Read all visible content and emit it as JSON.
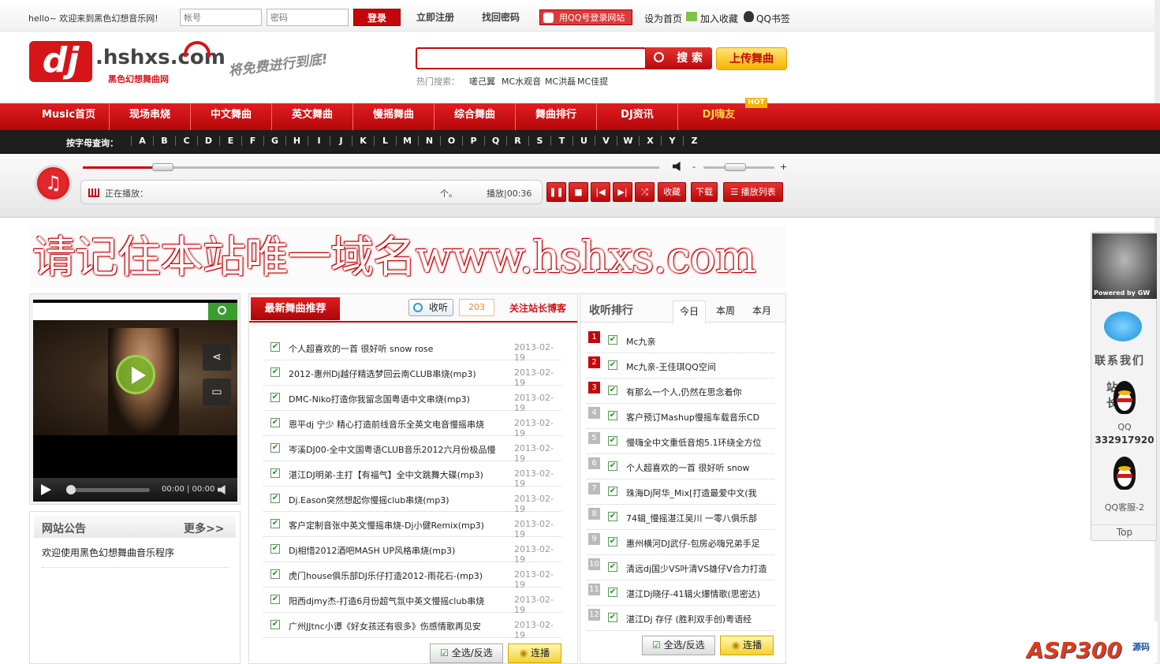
{
  "topbar": {
    "greeting": "hello~ 欢迎来到黑色幻想音乐网!",
    "username_placeholder": "帐号",
    "password_placeholder": "密码",
    "login": "登录",
    "register": "立即注册",
    "find_password": "找回密码",
    "qq_login": "用QQ号登录网站",
    "set_home": "设为首页",
    "add_fav": "加入收藏",
    "qq_bookmark": "QQ书签"
  },
  "header": {
    "logo_mark": "dj",
    "logo_main": ".hshxs.com",
    "logo_sub": "黑色幻想舞曲网",
    "slogan": "将免费进行到底!",
    "search_button": "搜 索",
    "upload_button": "上传舞曲",
    "hot_label": "热门搜索：",
    "hot_keywords": [
      "嗟己翼",
      "MC水观音",
      "MC洪磊",
      "MC佳提"
    ]
  },
  "nav": {
    "items": [
      "Music首页",
      "现场串烧",
      "中文舞曲",
      "英文舞曲",
      "慢摇舞曲",
      "综合舞曲",
      "舞曲排行",
      "DJ资讯",
      "DJ嗨友"
    ],
    "hot_badge": "HOT"
  },
  "alpha": {
    "label": "按字母查询：",
    "letters": [
      "A",
      "B",
      "C",
      "D",
      "E",
      "F",
      "G",
      "H",
      "I",
      "J",
      "K",
      "L",
      "M",
      "N",
      "O",
      "P",
      "Q",
      "R",
      "S",
      "T",
      "U",
      "V",
      "W",
      "X",
      "Y",
      "Z"
    ]
  },
  "player": {
    "now_playing_label": "正在播放：",
    "count": "个。",
    "status": "播放|00:36",
    "volume_minus": "-",
    "volume_plus": "+",
    "btn_fav": "收藏",
    "btn_download": "下载",
    "btn_playlist": "播放列表",
    "progress": 0.14,
    "volume": 0.45
  },
  "banner": {
    "text": "请记住本站唯一域名www.hshxs.com"
  },
  "video": {
    "time": "00:00 | 00:00"
  },
  "notice": {
    "title": "网站公告",
    "more": "更多>>",
    "items": [
      "欢迎使用黑色幻想舞曲音乐程序"
    ]
  },
  "songs": {
    "tab": "最新舞曲推荐",
    "listen": "收听",
    "count": "203",
    "follow": "关注站长博客",
    "select_all": "全选/反选",
    "play": "连播",
    "items": [
      {
        "title": "个人超喜欢的一首 很好听 snow rose",
        "date": "2013-02-19"
      },
      {
        "title": "2012-惠州Dj越仔精选梦回云南CLUB串烧(mp3)",
        "date": "2013-02-19"
      },
      {
        "title": "DMC-Niko打造你我留念国粤语中文串烧(mp3)",
        "date": "2013-02-19"
      },
      {
        "title": "恩平dj 宁少 精心打造前线音乐全英文电音慢摇串烧",
        "date": "2013-02-19"
      },
      {
        "title": "岑溪DJ00-全中文国粤语CLUB音乐2012六月份极品慢",
        "date": "2013-02-19"
      },
      {
        "title": "湛江DJ明弟-主打【有福气】全中文跳舞大碟(mp3)",
        "date": "2013-02-19"
      },
      {
        "title": "Dj.Eason突然想起你慢摇club串烧(mp3)",
        "date": "2013-02-19"
      },
      {
        "title": "客户定制音张中英文慢摇串烧-Dj小健Remix(mp3)",
        "date": "2013-02-19"
      },
      {
        "title": "Dj相惜2012酒吧MASH UP风格串烧(mp3)",
        "date": "2013-02-19"
      },
      {
        "title": "虎门house俱乐部DJ乐仔打造2012-雨花石-(mp3)",
        "date": "2013-02-19"
      },
      {
        "title": "阳西djmy杰-打造6月份超气氛中英文慢摇club串烧",
        "date": "2013-02-19"
      },
      {
        "title": "广州JJtnc小谭《好女孩还有很多》伤感情歌再见安",
        "date": "2013-02-19"
      }
    ]
  },
  "rank": {
    "title": "收听排行",
    "tabs": [
      "今日",
      "本周",
      "本月"
    ],
    "select_all": "全选/反选",
    "play": "连播",
    "items": [
      "Mc九亲",
      "Mc九亲-王佳琪QQ空间",
      "有那么一个人,仍然在思念着你",
      "客户预订Mashup慢摇车载音乐CD",
      "慢嗨全中文重低音炮5.1环绕全方位",
      "个人超喜欢的一首 很好听 snow",
      "珠海Dj阿华_Mix[打造最爱中文(我",
      "74辑_慢摇湛江吴川 一零八俱乐部",
      "惠州横河DJ武仔-包房必嗨兄弟手足",
      "清远dj国少VS叶清VS雄仔V合力打造",
      "湛江Dj晓仔-41辑火爆情歌(思密达)",
      "湛江Dj 存仔 (胜利双手创)粤语经"
    ],
    "colors": {
      "top": "#c4060b",
      "rest": "#bbbbbb"
    }
  },
  "float": {
    "powered": "Powered by GW",
    "contact": "联系我们",
    "boss": "站长",
    "qq_label": "QQ",
    "qq_number": "332917920",
    "service": "QQ客服-2",
    "top": "Top"
  },
  "watermark": {
    "text": "ASP300",
    "suffix": "源码"
  }
}
